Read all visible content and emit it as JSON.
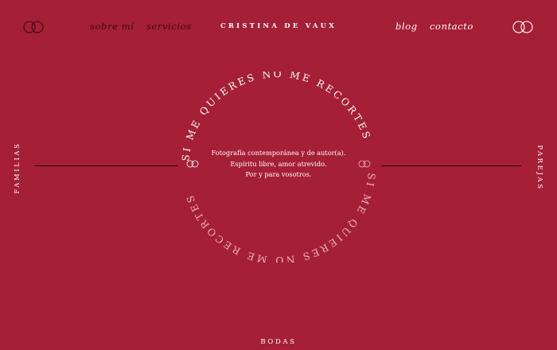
{
  "colors": {
    "background": "#a51f37",
    "text_light": "#ffffff",
    "text_dark": "#3a0a12",
    "line_dark": "#2a050c"
  },
  "header": {
    "brand": "CRISTINA DE VAUX",
    "nav_left": [
      "sobre mí",
      "servicios"
    ],
    "nav_right": [
      "blog",
      "contacto"
    ],
    "left_icon": "rings-icon",
    "right_icon": "rings-icon"
  },
  "side_labels": {
    "left": "FAMILIAS",
    "right": "PAREJAS",
    "bottom": "BODAS"
  },
  "circle_text": "SI ME QUIERES NO ME RECORTES",
  "tagline": [
    "Fotografía contemporánea y de autor(a).",
    "Espíritu libre, amor atrevido.",
    "Por y para vosotros."
  ]
}
